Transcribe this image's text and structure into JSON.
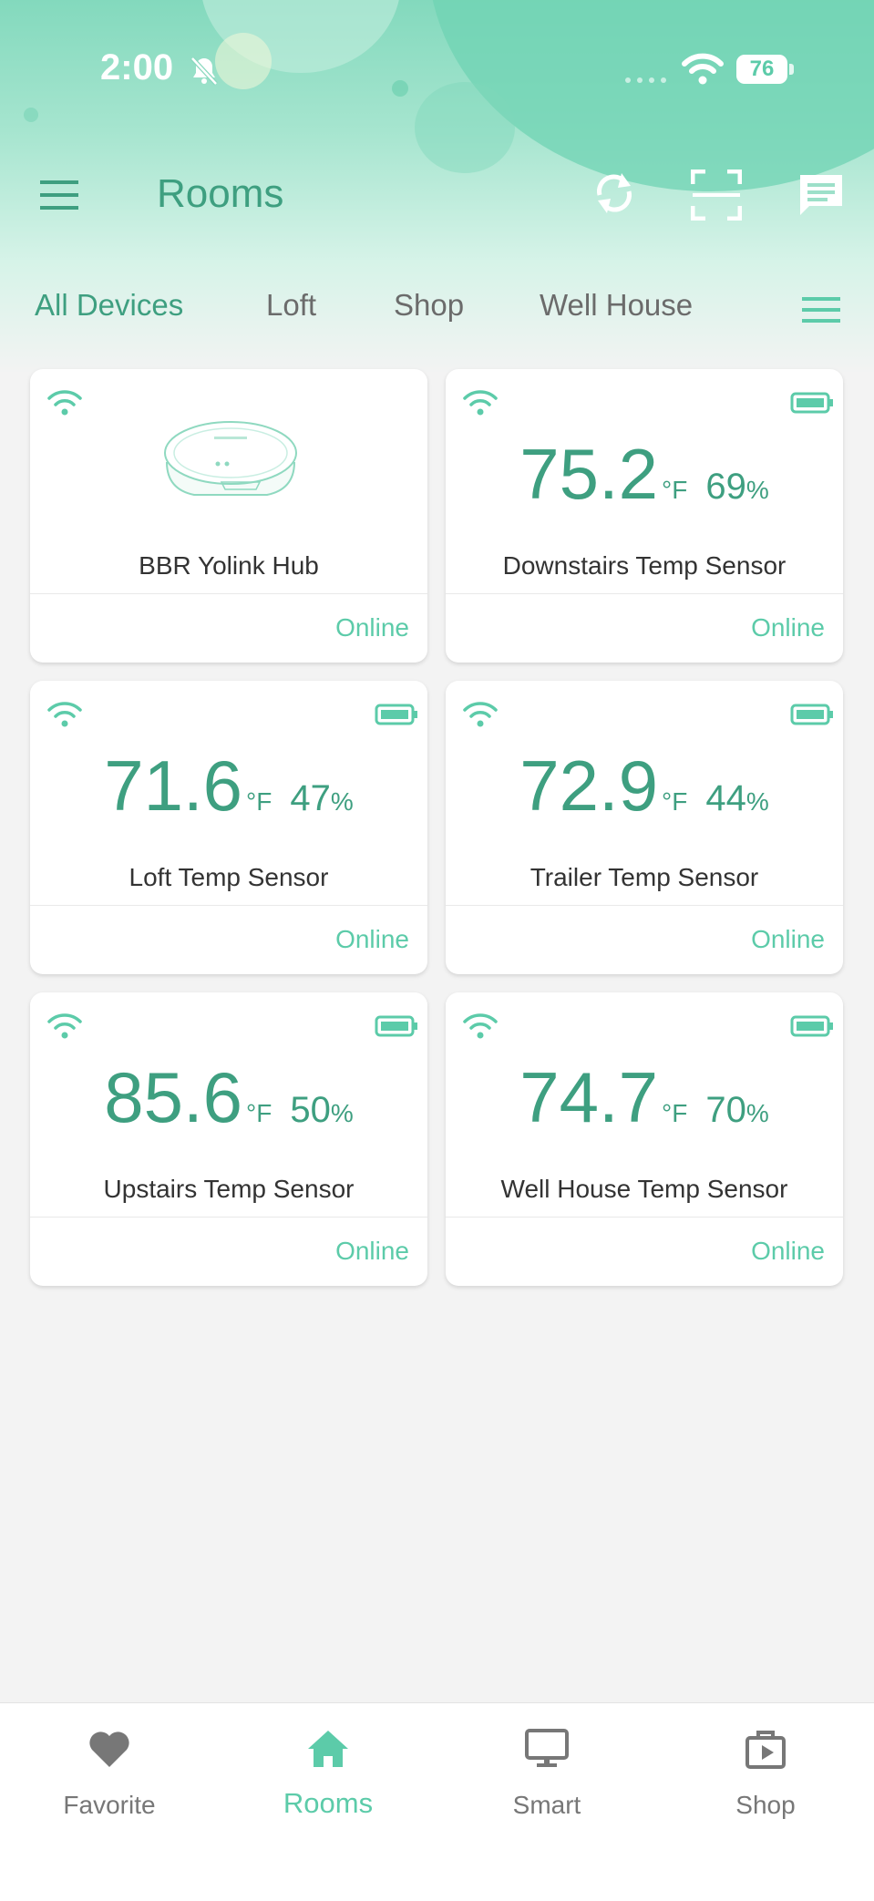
{
  "status_bar": {
    "time": "2:00",
    "battery": "76"
  },
  "header": {
    "title": "Rooms"
  },
  "tabs": [
    {
      "label": "All Devices",
      "active": true
    },
    {
      "label": "Loft",
      "active": false
    },
    {
      "label": "Shop",
      "active": false
    },
    {
      "label": "Well House",
      "active": false
    }
  ],
  "devices": [
    {
      "name": "BBR Yolink Hub",
      "type": "hub",
      "status": "Online"
    },
    {
      "name": "Downstairs Temp Sensor",
      "type": "sensor",
      "temp": "75.2",
      "unit": "°F",
      "humidity": "69",
      "humidity_unit": "%",
      "status": "Online"
    },
    {
      "name": "Loft Temp Sensor",
      "type": "sensor",
      "temp": "71.6",
      "unit": "°F",
      "humidity": "47",
      "humidity_unit": "%",
      "status": "Online"
    },
    {
      "name": "Trailer Temp Sensor",
      "type": "sensor",
      "temp": "72.9",
      "unit": "°F",
      "humidity": "44",
      "humidity_unit": "%",
      "status": "Online"
    },
    {
      "name": "Upstairs Temp Sensor",
      "type": "sensor",
      "temp": "85.6",
      "unit": "°F",
      "humidity": "50",
      "humidity_unit": "%",
      "status": "Online"
    },
    {
      "name": "Well House Temp Sensor",
      "type": "sensor",
      "temp": "74.7",
      "unit": "°F",
      "humidity": "70",
      "humidity_unit": "%",
      "status": "Online"
    }
  ],
  "bottom_nav": [
    {
      "label": "Favorite",
      "icon": "heart-icon",
      "active": false
    },
    {
      "label": "Rooms",
      "icon": "home-icon",
      "active": true
    },
    {
      "label": "Smart",
      "icon": "monitor-icon",
      "active": false
    },
    {
      "label": "Shop",
      "icon": "shopping-bag-icon",
      "active": false
    }
  ],
  "colors": {
    "accent": "#3e9f80",
    "accent_light": "#5ccba9",
    "background": "#f3f3f3",
    "card": "#ffffff"
  }
}
